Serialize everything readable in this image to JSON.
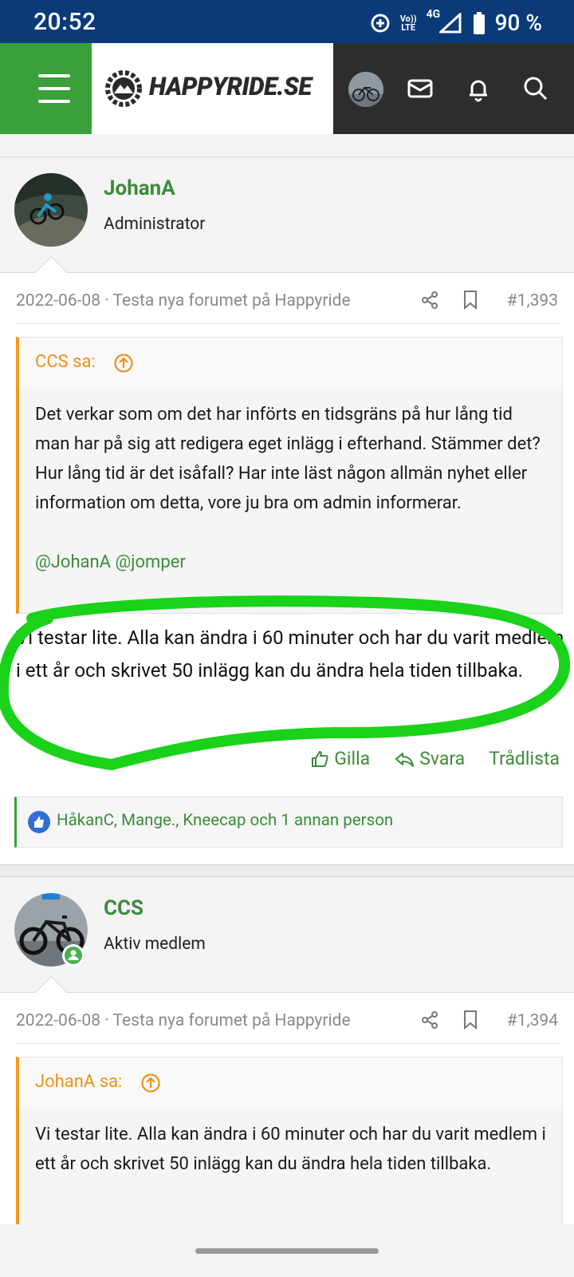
{
  "status_bar": {
    "time": "20:52",
    "network_top": "Vo))",
    "network_bottom": "LTE",
    "signal_label": "4G",
    "battery": "90 %"
  },
  "header": {
    "logo_text": "HAPPYRIDE.SE"
  },
  "posts": [
    {
      "username": "JohanA",
      "role": "Administrator",
      "date": "2022-06-08",
      "thread": "· Testa nya forumet på Happyride",
      "post_number": "#1,393",
      "quote_author": "CCS sa:",
      "quote_text": "Det verkar som om det har införts en tidsgräns på hur lång tid man har på sig att redigera eget inlägg i efterhand. Stämmer det? Hur lång tid är det isåfall? Har inte läst någon allmän nyhet eller information om detta, vore ju bra om admin informerar.",
      "quote_mentions": "@JohanA @jomper",
      "text": "Vi testar lite. Alla kan ändra i 60 minuter och har du varit medlem i ett år och skrivet 50 inlägg kan du ändra hela tiden tillbaka.",
      "actions": {
        "like": "Gilla",
        "reply": "Svara",
        "thread_list": "Trådlista"
      },
      "likes": "HåkanC, Mange., Kneecap och 1 annan person"
    },
    {
      "username": "CCS",
      "role": "Aktiv medlem",
      "date": "2022-06-08",
      "thread": "· Testa nya forumet på Happyride",
      "post_number": "#1,394",
      "quote_author": "JohanA sa:",
      "quote_text": "Vi testar lite. Alla kan ändra i 60 minuter och har du varit medlem i ett år och skrivet 50 inlägg kan du ändra hela tiden tillbaka."
    }
  ],
  "colors": {
    "status_bar": "#0b3a79",
    "menu_green": "#3aa13a",
    "link_green": "#3b8c3b",
    "quote_orange": "#f0901a",
    "highlight_marker": "#19d219"
  }
}
